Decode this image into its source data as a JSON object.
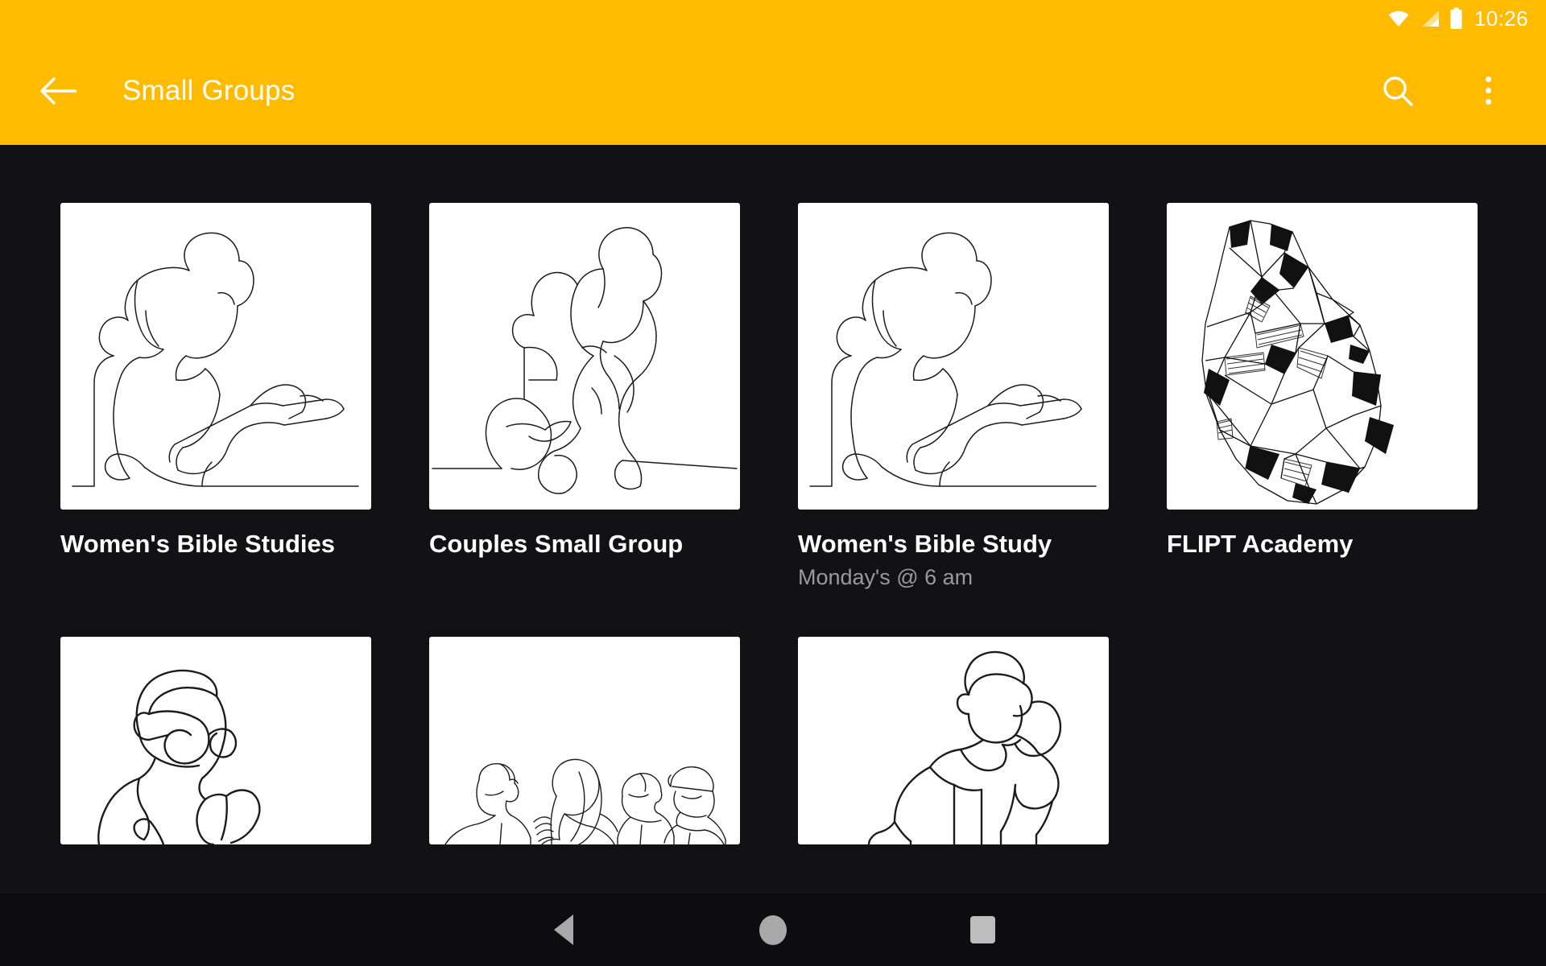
{
  "status_bar": {
    "time": "10:26",
    "icons": [
      "wifi-icon",
      "cell-signal-icon",
      "battery-icon"
    ]
  },
  "app_bar": {
    "back_icon": "back-arrow-icon",
    "title": "Small Groups",
    "search_icon": "search-icon",
    "overflow_icon": "overflow-menu-icon",
    "background_color": "#FFBB00",
    "foreground_color": "#FFFFFF"
  },
  "theme": {
    "background_color": "#121214",
    "card_background": "#FFFFFF",
    "title_color": "#FFFFFF",
    "subtitle_color": "#9A9A9A"
  },
  "groups": [
    {
      "title": "Women's Bible Studies",
      "subtitle": "",
      "image": "woman-reading-book-line-art",
      "thumb_shape": "square"
    },
    {
      "title": "Couples Small Group",
      "subtitle": "",
      "image": "couple-embracing-line-art",
      "thumb_shape": "square"
    },
    {
      "title": "Women's Bible Study",
      "subtitle": "Monday's @ 6 am",
      "image": "woman-reading-book-line-art",
      "thumb_shape": "square"
    },
    {
      "title": "FLIPT Academy",
      "subtitle": "",
      "image": "geometric-anatomical-heart",
      "thumb_shape": "square"
    },
    {
      "title": "",
      "subtitle": "",
      "image": "thinking-man-with-glasses-line-art",
      "thumb_shape": "wide"
    },
    {
      "title": "",
      "subtitle": "",
      "image": "group-conversation-line-art",
      "thumb_shape": "wide"
    },
    {
      "title": "",
      "subtitle": "",
      "image": "man-hand-behind-head-line-art",
      "thumb_shape": "wide"
    }
  ],
  "nav_bar": {
    "back_icon": "nav-back-triangle-icon",
    "home_icon": "nav-home-circle-icon",
    "recents_icon": "nav-recents-square-icon"
  }
}
